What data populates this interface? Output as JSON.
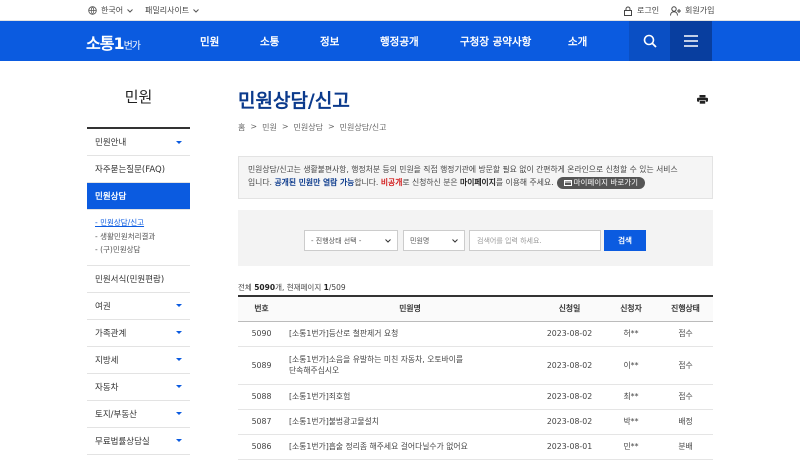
{
  "util": {
    "language": "한국어",
    "family_sites": "패밀리사이트",
    "login": "로그인",
    "signup": "회원가입"
  },
  "header": {
    "logo_main": "소통1",
    "logo_sub": "번가",
    "menu": [
      "민원",
      "소통",
      "정보",
      "행정공개",
      "구청장 공약사항",
      "소개"
    ]
  },
  "sidebar": {
    "title": "민원",
    "items": [
      {
        "label": "민원안내",
        "caret": true
      },
      {
        "label": "자주묻는질문(FAQ)",
        "caret": false
      },
      {
        "label": "민원상담",
        "caret": false,
        "active": true
      },
      {
        "label": "민원서식(민원편람)",
        "caret": false
      },
      {
        "label": "여권",
        "caret": true
      },
      {
        "label": "가족관계",
        "caret": true
      },
      {
        "label": "지방세",
        "caret": true
      },
      {
        "label": "자동차",
        "caret": true
      },
      {
        "label": "토지/부동산",
        "caret": true
      },
      {
        "label": "무료법률상담실",
        "caret": true
      }
    ],
    "sub": [
      "- 민원상담/신고",
      "- 생활민원처리결과",
      "- (구)민원상담"
    ]
  },
  "page": {
    "title": "민원상담/신고",
    "breadcrumb": [
      "홈",
      "민원",
      "민원상담",
      "민원상담/신고"
    ]
  },
  "info": {
    "line1": "민원상담/신고는 생활불편사항, 행정처분 등의 민원을 직접 행정기관에 방문할 필요 없이 간편하게 온라인으로 신청할 수 있는 서비스",
    "line2a": "입니다. ",
    "line2b": "공개된 민원만 열람 가능",
    "line2c": "합니다. ",
    "line2d": "비공개",
    "line2e": "로 신청하신 분은 ",
    "line2f": "마이페이지",
    "line2g": "를 이용해 주세요.",
    "mypage_button": "마이페이지 바로가기"
  },
  "search": {
    "status_select": "- 진행상태 선택 -",
    "field_select": "민원명",
    "placeholder": "검색어를 입력 하세요.",
    "button": "검색"
  },
  "summary": {
    "prefix": "전체 ",
    "total": "5090",
    "mid": "개, 현재페이지 ",
    "page": "1",
    "suffix": "/509"
  },
  "table": {
    "headers": [
      "번호",
      "민원명",
      "신청일",
      "신청자",
      "진행상태"
    ],
    "rows": [
      {
        "no": "5090",
        "title": "[소통1번가]등산로 철판제거 요청",
        "date": "2023-08-02",
        "user": "허**",
        "status": "접수"
      },
      {
        "no": "5089",
        "title": "[소통1번가]소음을 유발하는 미친 자동차, 오토바이를",
        "title2": "단속해주십시오",
        "date": "2023-08-02",
        "user": "이**",
        "status": "접수"
      },
      {
        "no": "5088",
        "title": "[소통1번가]죄호험",
        "date": "2023-08-02",
        "user": "최**",
        "status": "접수"
      },
      {
        "no": "5087",
        "title": "[소통1번가]불법광고물설치",
        "date": "2023-08-02",
        "user": "박**",
        "status": "배정"
      },
      {
        "no": "5086",
        "title": "[소통1번가]흡술 정리좀 해주세요 걸어다닐수가 없어요",
        "date": "2023-08-01",
        "user": "민**",
        "status": "분배"
      }
    ]
  }
}
